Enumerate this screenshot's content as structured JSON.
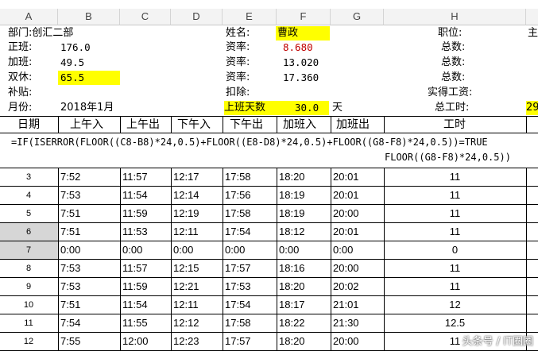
{
  "columns": [
    "A",
    "B",
    "C",
    "D",
    "E",
    "F",
    "G",
    "H"
  ],
  "info_rows": [
    {
      "a": "部门:创汇二部",
      "e": "姓名:",
      "f": "曹政",
      "h": "职位:",
      "i": "主"
    },
    {
      "a": "正班:",
      "b": "176.0",
      "e": "资率:",
      "f": "8.680",
      "h": "总数:"
    },
    {
      "a": "加班:",
      "b": "49.5",
      "e": "资率:",
      "f": "13.020",
      "h": "总数:"
    },
    {
      "a": "双休:",
      "b": "65.5",
      "e": "资率:",
      "f": "17.360",
      "h": "总数:"
    },
    {
      "a": "补贴:",
      "e": "扣除:",
      "h": "实得工资:"
    },
    {
      "a": "月份:",
      "b": "2018年1月",
      "e": "上班天数",
      "f": "30.0",
      "g": "天",
      "h": "总工时:",
      "i": "29"
    }
  ],
  "table_header": [
    "日期",
    "上午入",
    "上午出",
    "下午入",
    "下午出",
    "加班入",
    "加班出",
    "工时"
  ],
  "formula_line1": "=IF(ISERROR(FLOOR((C8-B8)*24,0.5)+FLOOR((E8-D8)*24,0.5)+FLOOR((G8-F8)*24,0.5))=TRUE",
  "formula_line2": "FLOOR((G8-F8)*24,0.5))",
  "rows": [
    {
      "d": "3",
      "b": "7:52",
      "c": "11:57",
      "dd": "12:17",
      "e": "17:58",
      "f": "18:20",
      "g": "20:01",
      "h": "11"
    },
    {
      "d": "4",
      "b": "7:53",
      "c": "11:54",
      "dd": "12:14",
      "e": "17:56",
      "f": "18:19",
      "g": "20:01",
      "h": "11"
    },
    {
      "d": "5",
      "b": "7:51",
      "c": "11:59",
      "dd": "12:19",
      "e": "17:58",
      "f": "18:19",
      "g": "20:00",
      "h": "11"
    },
    {
      "d": "6",
      "b": "7:51",
      "c": "11:53",
      "dd": "12:11",
      "e": "17:54",
      "f": "18:12",
      "g": "20:01",
      "h": "11"
    },
    {
      "d": "7",
      "b": "0:00",
      "c": "0:00",
      "dd": "0:00",
      "e": "0:00",
      "f": "0:00",
      "g": "0:00",
      "h": "0"
    },
    {
      "d": "8",
      "b": "7:53",
      "c": "11:57",
      "dd": "12:15",
      "e": "17:57",
      "f": "18:16",
      "g": "20:00",
      "h": "11"
    },
    {
      "d": "9",
      "b": "7:53",
      "c": "11:59",
      "dd": "12:21",
      "e": "17:53",
      "f": "18:20",
      "g": "20:02",
      "h": "11"
    },
    {
      "d": "10",
      "b": "7:51",
      "c": "11:54",
      "dd": "12:11",
      "e": "17:54",
      "f": "18:17",
      "g": "21:01",
      "h": "12"
    },
    {
      "d": "11",
      "b": "7:54",
      "c": "11:55",
      "dd": "12:12",
      "e": "17:58",
      "f": "18:22",
      "g": "21:30",
      "h": "12.5"
    },
    {
      "d": "12",
      "b": "7:55",
      "c": "12:00",
      "dd": "12:23",
      "e": "17:57",
      "f": "18:20",
      "g": "20:00",
      "h": "11"
    }
  ],
  "watermark": "头条号 / IT圈圈",
  "colors": {
    "highlight": "#ffff00",
    "rate_red": "#c00000",
    "header_bg": "#f3f3f3"
  }
}
